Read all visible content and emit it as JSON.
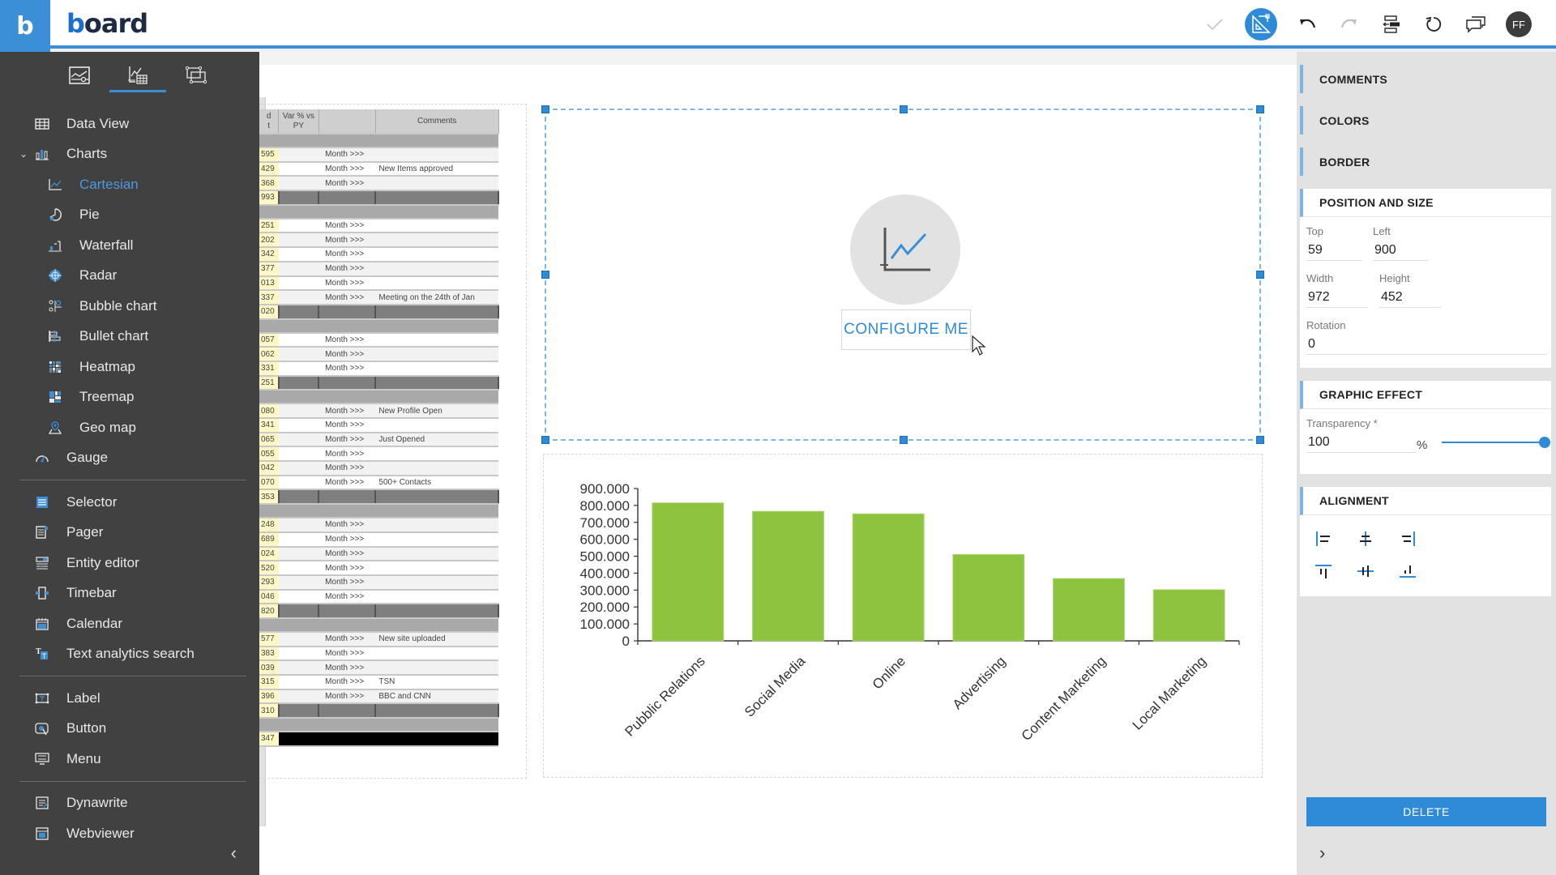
{
  "app": {
    "brand_letter": "b",
    "logo_text_b": "b",
    "logo_text_rest": "oard"
  },
  "toolbar": {
    "user_initials": "FF",
    "icons": [
      "check-icon",
      "design-mode-icon",
      "undo-icon",
      "redo-icon",
      "align-panel-icon",
      "refresh-icon",
      "comments-icon"
    ]
  },
  "sidebar": {
    "tabs": [
      {
        "name": "layout-tab",
        "active": false
      },
      {
        "name": "objects-tab",
        "active": true
      },
      {
        "name": "containers-tab",
        "active": false
      }
    ],
    "groups": [
      [
        {
          "label": "Data View",
          "level": 1,
          "icon": "grid-icon"
        },
        {
          "label": "Charts",
          "level": 1,
          "icon": "bar-chart-icon",
          "expanded": true
        },
        {
          "label": "Cartesian",
          "level": 2,
          "icon": "line-chart-icon",
          "active": true
        },
        {
          "label": "Pie",
          "level": 2,
          "icon": "pie-icon"
        },
        {
          "label": "Waterfall",
          "level": 2,
          "icon": "waterfall-icon"
        },
        {
          "label": "Radar",
          "level": 2,
          "icon": "radar-icon"
        },
        {
          "label": "Bubble chart",
          "level": 2,
          "icon": "bubble-icon"
        },
        {
          "label": "Bullet chart",
          "level": 2,
          "icon": "bullet-icon"
        },
        {
          "label": "Heatmap",
          "level": 2,
          "icon": "heatmap-icon"
        },
        {
          "label": "Treemap",
          "level": 2,
          "icon": "treemap-icon"
        },
        {
          "label": "Geo map",
          "level": 2,
          "icon": "map-pin-icon"
        },
        {
          "label": "Gauge",
          "level": 1,
          "icon": "gauge-icon"
        }
      ],
      [
        {
          "label": "Selector",
          "level": 1,
          "icon": "selector-icon"
        },
        {
          "label": "Pager",
          "level": 1,
          "icon": "pager-icon"
        },
        {
          "label": "Entity editor",
          "level": 1,
          "icon": "entity-editor-icon"
        },
        {
          "label": "Timebar",
          "level": 1,
          "icon": "timebar-icon"
        },
        {
          "label": "Calendar",
          "level": 1,
          "icon": "calendar-icon"
        },
        {
          "label": "Text analytics search",
          "level": 1,
          "icon": "text-search-icon"
        }
      ],
      [
        {
          "label": "Label",
          "level": 1,
          "icon": "label-icon"
        },
        {
          "label": "Button",
          "level": 1,
          "icon": "button-icon"
        },
        {
          "label": "Menu",
          "level": 1,
          "icon": "menu-icon"
        }
      ],
      [
        {
          "label": "Dynawrite",
          "level": 1,
          "icon": "dynawrite-icon"
        },
        {
          "label": "Webviewer",
          "level": 1,
          "icon": "webviewer-icon"
        }
      ]
    ]
  },
  "dataview": {
    "headers": [
      "d\nt",
      "Var % vs PY",
      "",
      "Comments"
    ],
    "rows": [
      {
        "type": "grp"
      },
      {
        "type": "alt",
        "num": "595",
        "mon": "Month >>>",
        "cm": ""
      },
      {
        "type": "row",
        "num": "429",
        "mon": "Month >>>",
        "cm": "New Items approved"
      },
      {
        "type": "alt",
        "num": "368",
        "mon": "Month >>>",
        "cm": ""
      },
      {
        "type": "sub",
        "num": "993"
      },
      {
        "type": "grp"
      },
      {
        "type": "row",
        "num": "251",
        "mon": "Month >>>",
        "cm": ""
      },
      {
        "type": "alt",
        "num": "202",
        "mon": "Month >>>",
        "cm": ""
      },
      {
        "type": "row",
        "num": "342",
        "mon": "Month >>>",
        "cm": ""
      },
      {
        "type": "alt",
        "num": "377",
        "mon": "Month >>>",
        "cm": ""
      },
      {
        "type": "row",
        "num": "013",
        "mon": "Month >>>",
        "cm": ""
      },
      {
        "type": "alt",
        "num": "337",
        "mon": "Month >>>",
        "cm": "Meeting on the 24th of Jan"
      },
      {
        "type": "sub",
        "num": "020"
      },
      {
        "type": "grp"
      },
      {
        "type": "row",
        "num": "057",
        "mon": "Month >>>",
        "cm": ""
      },
      {
        "type": "alt",
        "num": "062",
        "mon": "Month >>>",
        "cm": ""
      },
      {
        "type": "row",
        "num": "331",
        "mon": "Month >>>",
        "cm": ""
      },
      {
        "type": "sub",
        "num": "251"
      },
      {
        "type": "grp"
      },
      {
        "type": "alt",
        "num": "080",
        "mon": "Month >>>",
        "cm": "New Profile Open"
      },
      {
        "type": "row",
        "num": "341",
        "mon": "Month >>>",
        "cm": ""
      },
      {
        "type": "alt",
        "num": "065",
        "mon": "Month >>>",
        "cm": "Just Opened"
      },
      {
        "type": "row",
        "num": "055",
        "mon": "Month >>>",
        "cm": ""
      },
      {
        "type": "alt",
        "num": "042",
        "mon": "Month >>>",
        "cm": ""
      },
      {
        "type": "row",
        "num": "070",
        "mon": "Month >>>",
        "cm": "500+ Contacts"
      },
      {
        "type": "sub",
        "num": "353"
      },
      {
        "type": "grp"
      },
      {
        "type": "alt",
        "num": "248",
        "mon": "Month >>>",
        "cm": ""
      },
      {
        "type": "row",
        "num": "689",
        "mon": "Month >>>",
        "cm": ""
      },
      {
        "type": "alt",
        "num": "024",
        "mon": "Month >>>",
        "cm": ""
      },
      {
        "type": "row",
        "num": "520",
        "mon": "Month >>>",
        "cm": ""
      },
      {
        "type": "alt",
        "num": "293",
        "mon": "Month >>>",
        "cm": ""
      },
      {
        "type": "row",
        "num": "046",
        "mon": "Month >>>",
        "cm": ""
      },
      {
        "type": "sub",
        "num": "820"
      },
      {
        "type": "grp"
      },
      {
        "type": "alt",
        "num": "577",
        "mon": "Month >>>",
        "cm": "New site uploaded"
      },
      {
        "type": "row",
        "num": "383",
        "mon": "Month >>>",
        "cm": ""
      },
      {
        "type": "alt",
        "num": "039",
        "mon": "Month >>>",
        "cm": ""
      },
      {
        "type": "row",
        "num": "315",
        "mon": "Month >>>",
        "cm": "TSN"
      },
      {
        "type": "alt",
        "num": "396",
        "mon": "Month >>>",
        "cm": "BBC and CNN"
      },
      {
        "type": "sub",
        "num": "310"
      },
      {
        "type": "grp"
      },
      {
        "type": "tot",
        "num": "347"
      }
    ]
  },
  "placeholder": {
    "configure_label": "CONFIGURE ME"
  },
  "chart_data": {
    "type": "bar",
    "title": "",
    "xlabel": "",
    "ylabel": "",
    "categories": [
      "Pubblic Relations",
      "Social Media",
      "Online",
      "Advertising",
      "Content Marketing",
      "Local Marketing"
    ],
    "values": [
      815000,
      765000,
      750000,
      510000,
      368000,
      302000
    ],
    "ylim": [
      0,
      900000
    ],
    "yticks": [
      0,
      100000,
      200000,
      300000,
      400000,
      500000,
      600000,
      700000,
      800000,
      900000
    ],
    "ytick_labels": [
      "0",
      "100.000",
      "200.000",
      "300.000",
      "400.000",
      "500.000",
      "600.000",
      "700.000",
      "800.000",
      "900.000"
    ],
    "bar_color": "#8dc33f",
    "grid": false,
    "legend": "none"
  },
  "properties": {
    "sections": {
      "comments": "COMMENTS",
      "colors": "COLORS",
      "border": "BORDER",
      "position": "POSITION AND SIZE",
      "graphic": "GRAPHIC EFFECT",
      "alignment": "ALIGNMENT"
    },
    "position": {
      "top_label": "Top",
      "top": "59",
      "left_label": "Left",
      "left": "900",
      "width_label": "Width",
      "width": "972",
      "height_label": "Height",
      "height": "452",
      "rotation_label": "Rotation",
      "rotation": "0"
    },
    "graphic": {
      "transparency_label": "Transparency *",
      "transparency": "100",
      "unit": "%",
      "slider_percent": 100
    },
    "alignment_buttons": [
      "align-left-icon",
      "align-center-h-icon",
      "align-right-icon",
      "align-top-icon",
      "align-middle-v-icon",
      "align-bottom-icon"
    ],
    "delete_label": "DELETE"
  },
  "colors": {
    "accent": "#2f8ad8",
    "sidebar_bg": "#414141",
    "bar": "#8dc33f"
  }
}
